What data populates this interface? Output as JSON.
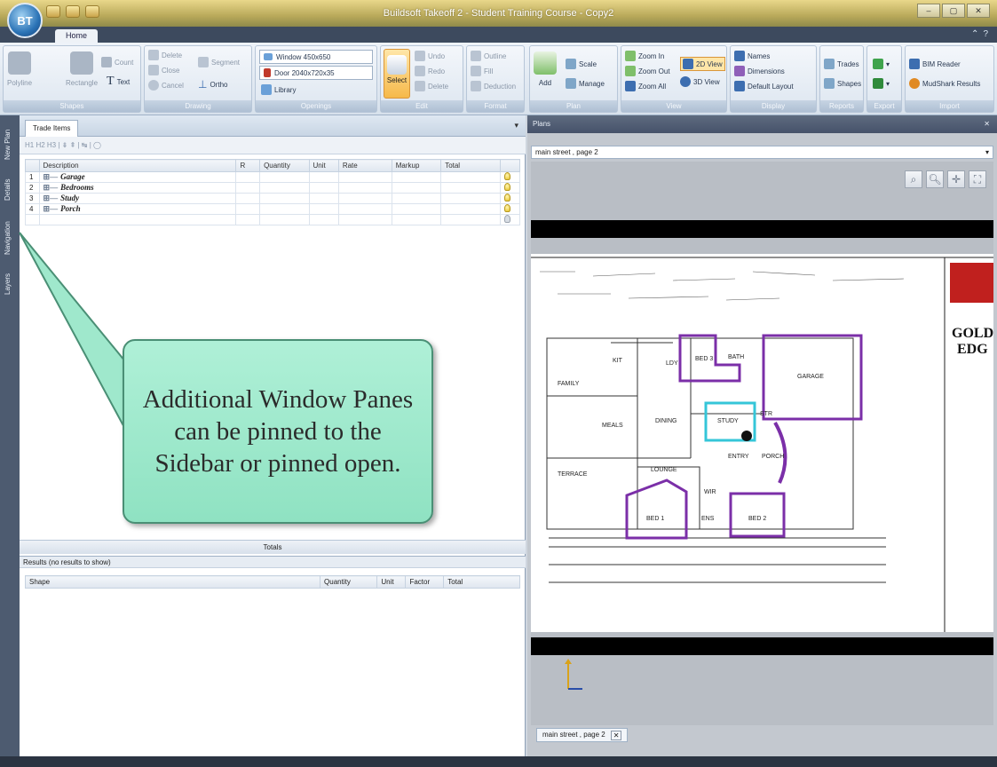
{
  "window": {
    "title": "Buildsoft Takeoff 2 - Student Training Course - Copy2",
    "orb_label": "BT",
    "controls": [
      "–",
      "▢",
      "✕"
    ]
  },
  "tabs": {
    "home": "Home"
  },
  "ribbon": {
    "shapes": {
      "label": "Shapes",
      "polyline": "Polyline",
      "rectangle": "Rectangle",
      "count": "Count",
      "text": "Text"
    },
    "drawing": {
      "label": "Drawing",
      "delete": "Delete",
      "close": "Close",
      "cancel": "Cancel",
      "orthe": "Ortho",
      "segment": "Segment"
    },
    "openings": {
      "label": "Openings",
      "window": "Window 450x650",
      "door": "Door 2040x720x35",
      "library": "Library"
    },
    "edit": {
      "label": "Edit",
      "select": "Select",
      "undo": "Undo",
      "redo": "Redo",
      "delete": "Delete"
    },
    "format": {
      "label": "Format",
      "outline": "Outline",
      "fill": "Fill",
      "deduction": "Deduction"
    },
    "plan": {
      "label": "Plan",
      "add": "Add",
      "scale": "Scale",
      "manage": "Manage"
    },
    "view": {
      "label": "View",
      "zoom_in": "Zoom In",
      "zoom_out": "Zoom Out",
      "zoom_all": "Zoom All",
      "view2d": "2D View",
      "view3d": "3D View"
    },
    "display": {
      "label": "Display",
      "names": "Names",
      "dimensions": "Dimensions",
      "default_layout": "Default Layout"
    },
    "reports": {
      "label": "Reports",
      "trades": "Trades",
      "shapes": "Shapes"
    },
    "export": {
      "label": "Export"
    },
    "import": {
      "label": "Import",
      "bim": "BIM Reader",
      "mudshark": "MudShark Results"
    }
  },
  "sidebar_tabs": [
    "New Plan",
    "Details",
    "Navigation",
    "Layers"
  ],
  "left_pane": {
    "tab": "Trade Items",
    "toolbar": "H1 H2 H3 | ⇟ ⇞ | ↹ | ◯",
    "columns": [
      "",
      "Description",
      "R",
      "Quantity",
      "Unit",
      "Rate",
      "Markup",
      "Total",
      ""
    ],
    "rows": [
      {
        "num": "1",
        "desc": "Garage"
      },
      {
        "num": "2",
        "desc": "Bedrooms"
      },
      {
        "num": "3",
        "desc": "Study"
      },
      {
        "num": "4",
        "desc": "Porch"
      }
    ],
    "totals": "Totals",
    "results_title": "Results (no results to show)",
    "results_columns": [
      "Shape",
      "Quantity",
      "Unit",
      "Factor",
      "Total"
    ]
  },
  "callout": {
    "text": "Additional Window Panes can be pinned to the Sidebar or pinned open."
  },
  "right_pane": {
    "header": "Plans",
    "page": "main street , page 2",
    "doc_tab": "main street , page 2",
    "doc_tab_close": "✕"
  },
  "plan": {
    "rooms": [
      "KIT",
      "BED 3",
      "GARAGE",
      "FAMILY",
      "STUDY",
      "MEALS",
      "DINING",
      "ENTRY",
      "PORCH",
      "LOUNGE",
      "TERRACE",
      "WIR",
      "BED 1",
      "BED 2",
      "ENS",
      "LDY",
      "BATH",
      "STR"
    ],
    "brand_top": "GOLD",
    "brand_bottom": "EDG"
  },
  "colors": {
    "accent": "#7b2fa8",
    "study_outline": "#35c6d8",
    "callout": "#9fe8cc"
  }
}
